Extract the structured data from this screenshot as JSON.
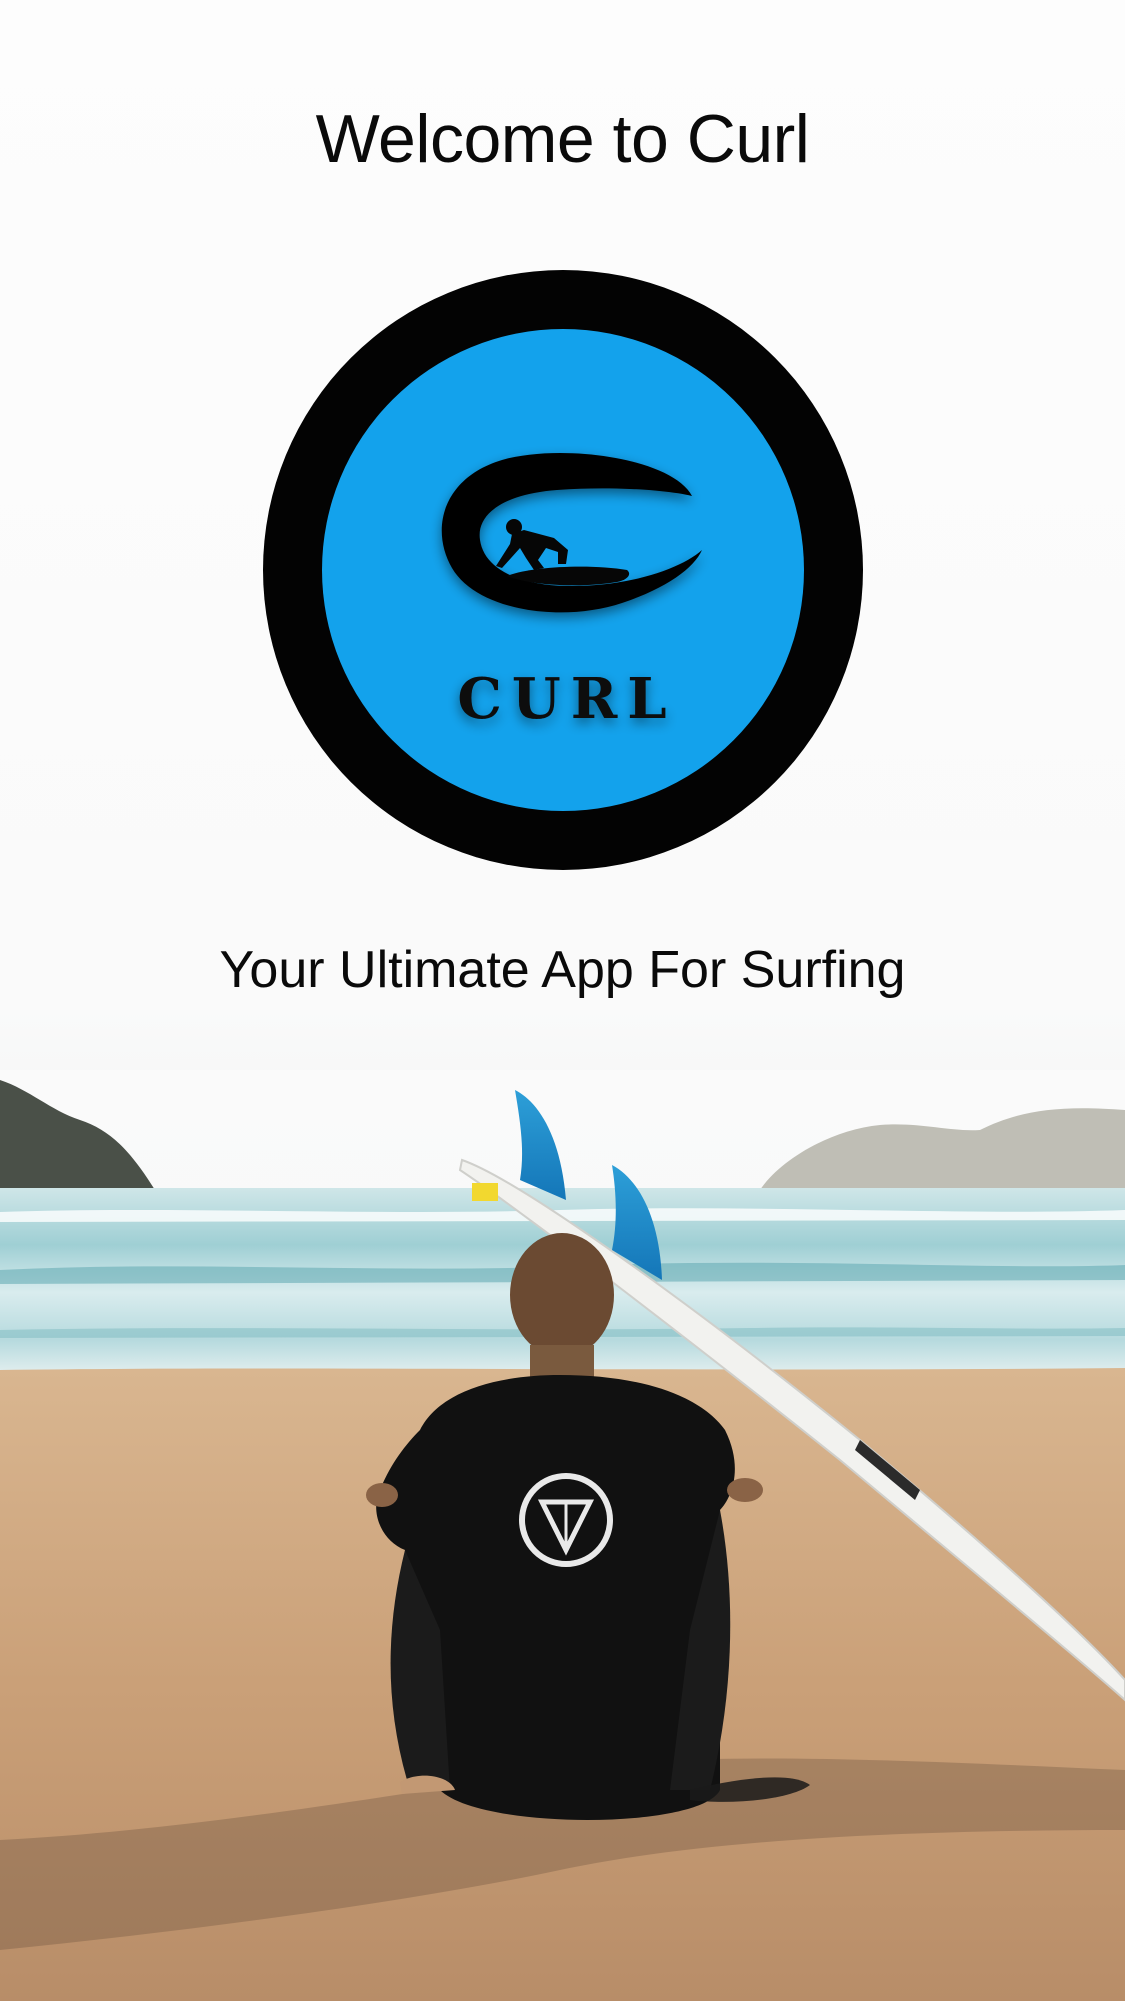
{
  "screen": {
    "title": "Welcome to Curl",
    "tagline": "Your Ultimate App For Surfing"
  },
  "logo": {
    "wordmark": "CURL",
    "ring_color": "#030303",
    "fill_color": "#13a2ec"
  },
  "photo": {
    "description_icon": "surfer-sitting-on-beach-image"
  },
  "colors": {
    "background": "#fbfbfb",
    "text": "#0a0a0a",
    "sand": "#cfa27a",
    "sea": "#b9dde0"
  }
}
